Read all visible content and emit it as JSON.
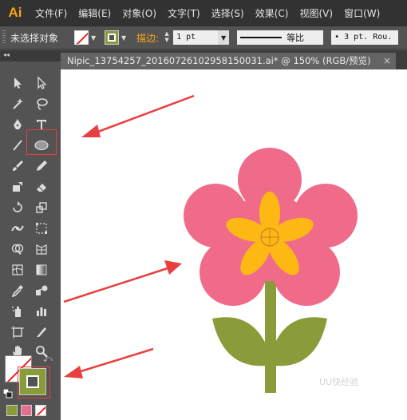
{
  "app": {
    "logo": "Ai",
    "accent": "#f7a21b"
  },
  "menu": [
    "文件(F)",
    "编辑(E)",
    "对象(O)",
    "文字(T)",
    "选择(S)",
    "效果(C)",
    "视图(V)",
    "窗口(W)"
  ],
  "control_bar": {
    "selection_status": "未选择对象",
    "stroke_label": "描边:",
    "stroke_weight": "1 pt",
    "profile_label": "等比",
    "brush": "• 3 pt. Rou."
  },
  "document_tab": {
    "title": "Nipic_13754257_20160726102958150031.ai* @ 150% (RGB/预览)",
    "close_glyph": "×"
  },
  "toolbox": {
    "collapse_glyph": "◂◂",
    "fill_color": "none",
    "stroke_color": "#8a9b3a",
    "swatch_colors": [
      "#8a9b3a",
      "#e96d90",
      "none"
    ]
  },
  "artwork": {
    "petal_color": "#f06b8a",
    "inner_petal_color": "#fdb813",
    "stem_color": "#8a9b3a",
    "annotation_color": "#e84040"
  },
  "watermark": "UU快经验"
}
